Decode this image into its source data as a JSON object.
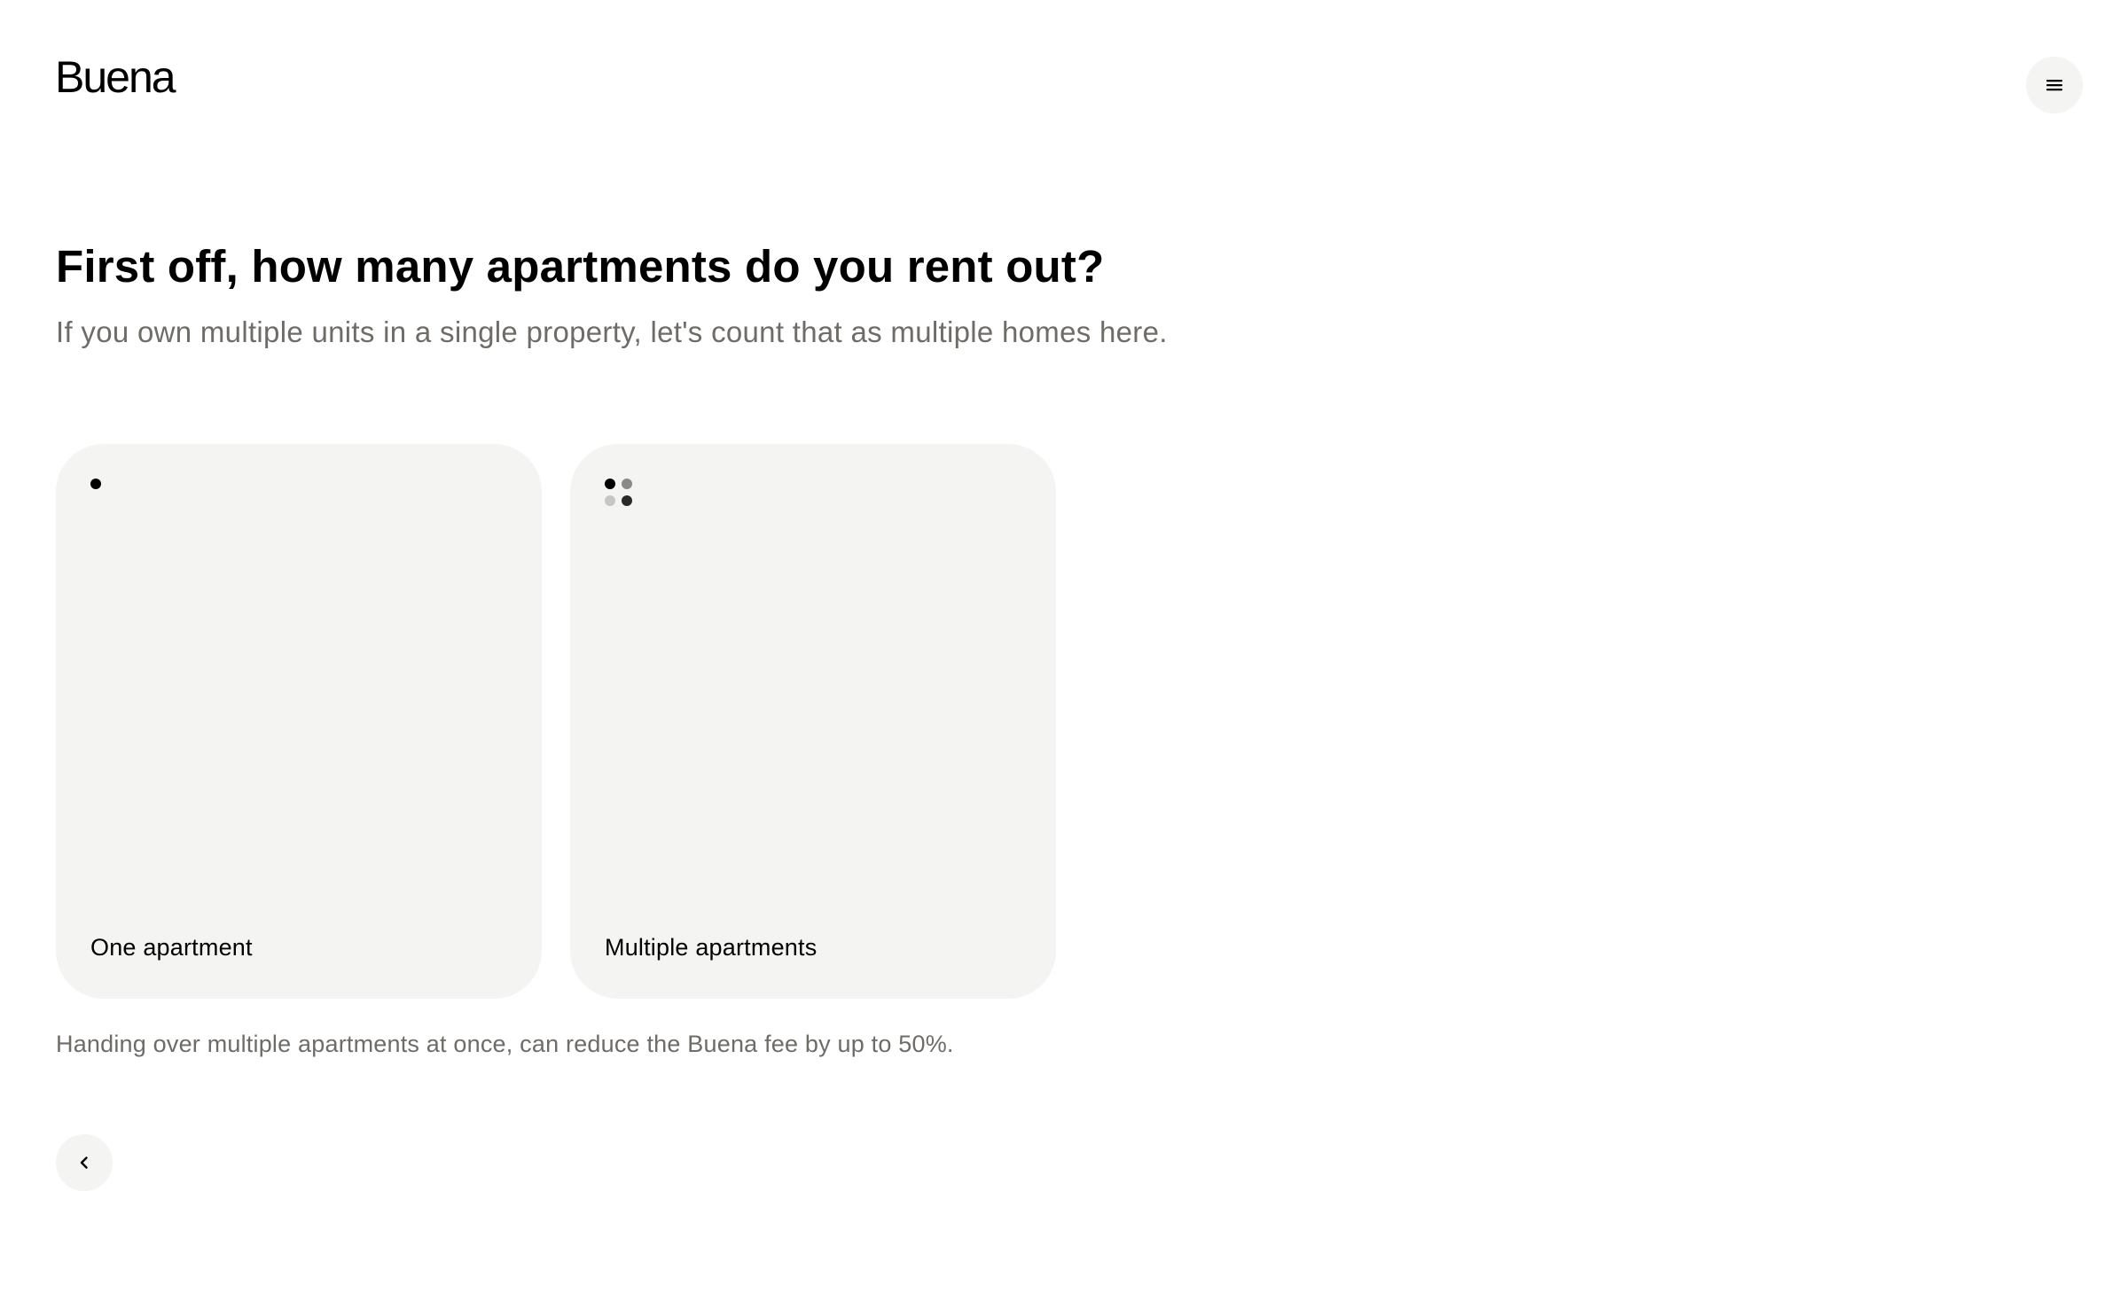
{
  "header": {
    "logo_text": "Buena",
    "menu_icon": "hamburger-menu-icon"
  },
  "question": {
    "title": "First off, how many apartments do you rent out?",
    "subtitle": "If you own multiple units in a single property, let's count that as multiple homes here."
  },
  "options": [
    {
      "label": "One apartment",
      "icon": "single-dot-icon"
    },
    {
      "label": "Multiple apartments",
      "icon": "four-dots-icon"
    }
  ],
  "footnote": "Handing over multiple apartments at once, can reduce the Buena fee by up to 50%.",
  "navigation": {
    "back_icon": "chevron-left-icon"
  },
  "colors": {
    "background": "#ffffff",
    "card_background": "#f4f4f2",
    "text_primary": "#000000",
    "text_secondary": "#6f6c68"
  }
}
